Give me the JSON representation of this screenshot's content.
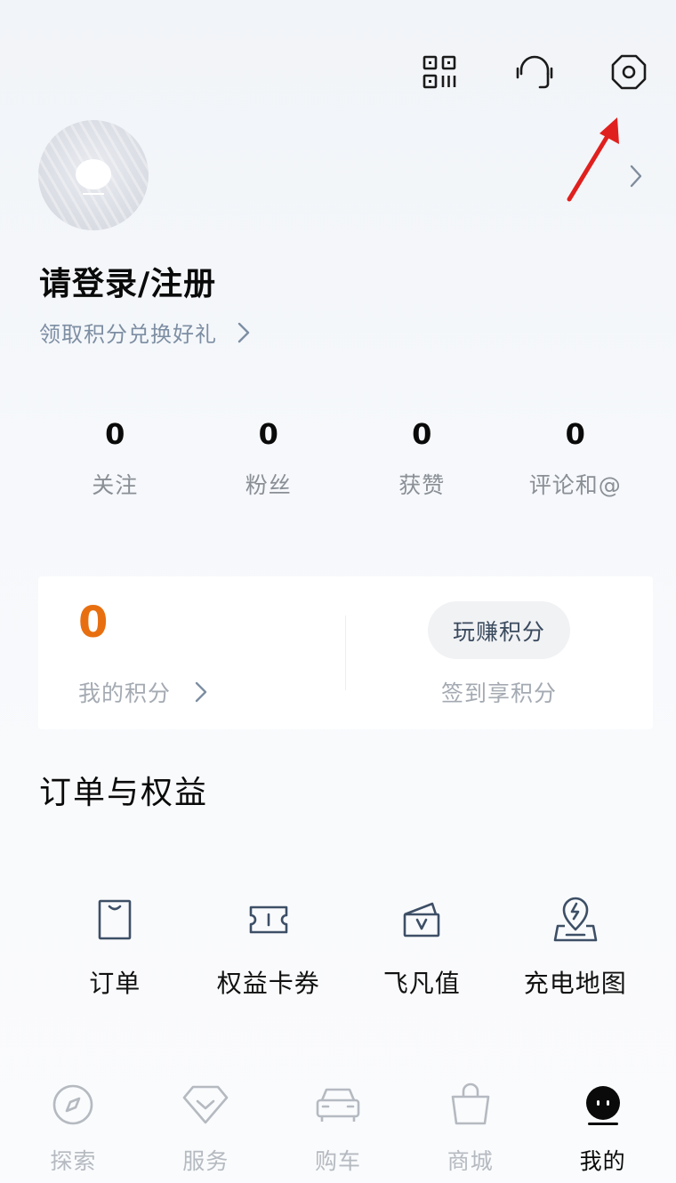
{
  "header": {
    "icons": [
      "qr-code-icon",
      "headset-icon",
      "settings-icon"
    ]
  },
  "profile": {
    "login_title": "请登录/注册",
    "points_link_label": "领取积分兑换好礼"
  },
  "stats": [
    {
      "value": "0",
      "label": "关注"
    },
    {
      "value": "0",
      "label": "粉丝"
    },
    {
      "value": "0",
      "label": "获赞"
    },
    {
      "value": "0",
      "label": "评论和@"
    }
  ],
  "points_card": {
    "points_value": "0",
    "my_points_label": "我的积分",
    "earn_button_label": "玩赚积分",
    "signin_label": "签到享积分"
  },
  "orders_section": {
    "title": "订单与权益",
    "items": [
      {
        "label": "订单",
        "icon": "order-bag-icon"
      },
      {
        "label": "权益卡券",
        "icon": "coupon-icon"
      },
      {
        "label": "飞凡值",
        "icon": "wallet-icon"
      },
      {
        "label": "充电地图",
        "icon": "charging-map-icon"
      }
    ]
  },
  "tabbar": {
    "items": [
      {
        "label": "探索",
        "icon": "compass-icon",
        "active": false
      },
      {
        "label": "服务",
        "icon": "diamond-icon",
        "active": false
      },
      {
        "label": "购车",
        "icon": "car-icon",
        "active": false
      },
      {
        "label": "商城",
        "icon": "shopping-bag-icon",
        "active": false
      },
      {
        "label": "我的",
        "icon": "profile-face-icon",
        "active": true
      }
    ]
  },
  "colors": {
    "accent_points": "#e86f10",
    "secondary_text": "#8a8f96",
    "link_text": "#7d8ea3",
    "icon_stroke": "#3d4f66",
    "annotation_red": "#e0201e"
  }
}
